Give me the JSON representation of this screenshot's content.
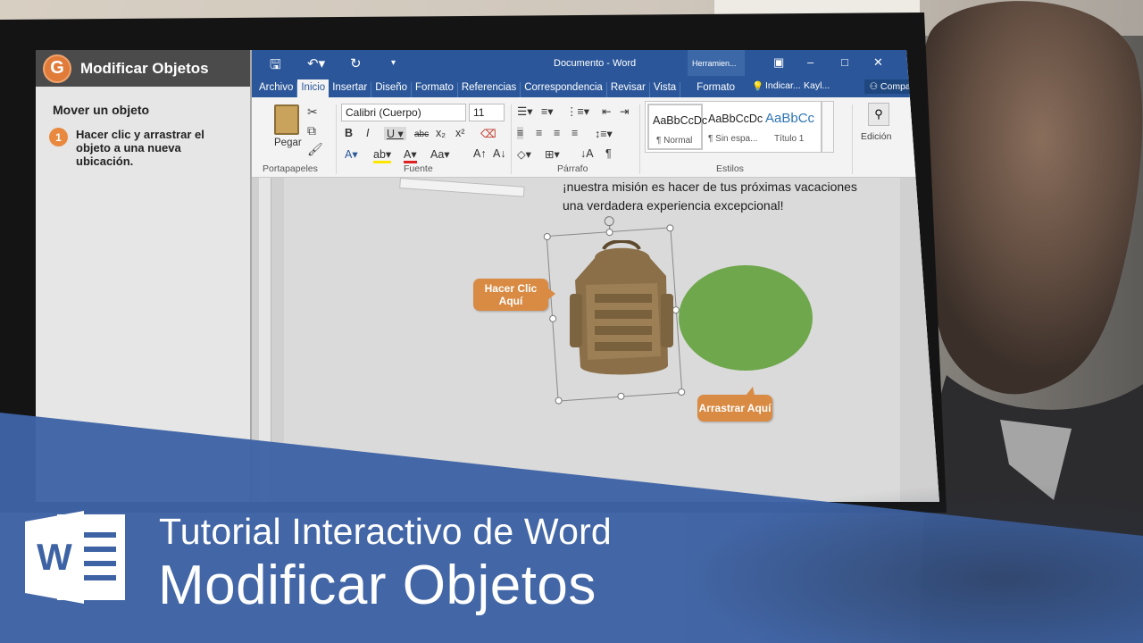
{
  "tutorial": {
    "title": "Modificar Objetos",
    "section": "Mover un objeto",
    "step_number": "1",
    "step_text": "Hacer clic y arrastrar el objeto a una nueva ubicación."
  },
  "word": {
    "document_title": "Documento - Word",
    "context_tools": "Herramien...",
    "tabs": [
      {
        "label": "Archivo"
      },
      {
        "label": "Inicio"
      },
      {
        "label": "Insertar"
      },
      {
        "label": "Diseño"
      },
      {
        "label": "Formato"
      },
      {
        "label": "Referencias"
      },
      {
        "label": "Correspondencia"
      },
      {
        "label": "Revisar"
      },
      {
        "label": "Vista"
      },
      {
        "label": "Formato"
      }
    ],
    "tell_me": "Indicar...",
    "user": "Kayl...",
    "share": "Compartir",
    "ribbon": {
      "paste": "Pegar",
      "clipboard_group": "Portapapeles",
      "font_name": "Calibri (Cuerpo)",
      "font_size": "11",
      "font_group": "Fuente",
      "paragraph_group": "Párrafo",
      "styles_group": "Estilos",
      "editing": "Edición",
      "styles": [
        {
          "sample": "AaBbCcDc",
          "name": "¶ Normal"
        },
        {
          "sample": "AaBbCcDc",
          "name": "¶ Sin espa..."
        },
        {
          "sample": "AaBbCc",
          "name": "Título 1"
        }
      ]
    },
    "document": {
      "text_line1": "¡nuestra misión es hacer de tus próximas vacaciones",
      "text_line2": "una verdadera experiencia excepcional!"
    },
    "callouts": {
      "click": "Hacer Clic Aquí",
      "drag": "Arrastrar Aquí"
    }
  },
  "banner": {
    "subtitle": "Tutorial Interactivo de Word",
    "title": "Modificar Objetos"
  },
  "colors": {
    "word_blue": "#2b579a",
    "callout_orange": "#d98a43",
    "ellipse_green": "#6fa74c",
    "banner_blue": "#3e63a5"
  }
}
